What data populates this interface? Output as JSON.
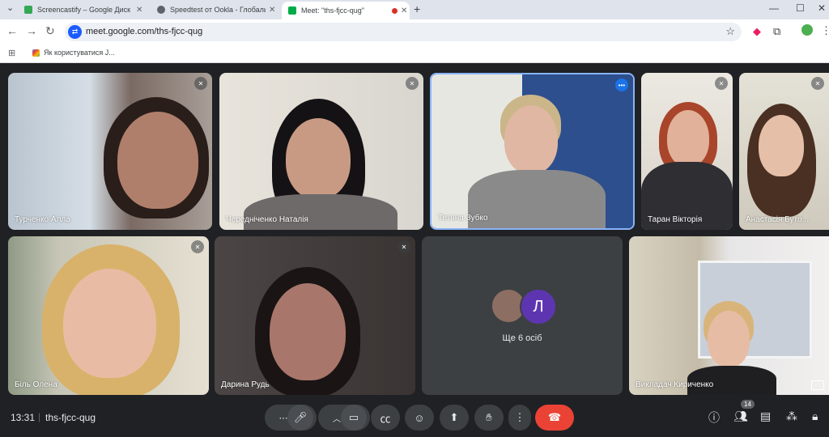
{
  "browser": {
    "tabs": [
      {
        "title": "Screencastify – Google Диск",
        "active": false
      },
      {
        "title": "Speedtest от Ookla - Глобальный",
        "active": false
      },
      {
        "title": "Meet: \"ths-fjcc-qug\"",
        "active": true
      }
    ],
    "url": "meet.google.com/ths-fjcc-qug",
    "bookmark": "Як користуватися J..."
  },
  "participants": [
    {
      "name": "Турченко Алла",
      "mic": "muted"
    },
    {
      "name": "Чередніченко Наталія",
      "mic": "muted"
    },
    {
      "name": "Тетяна Зубко",
      "mic": "speaking"
    },
    {
      "name": "Таран Вікторія",
      "mic": "muted"
    },
    {
      "name": "Анастасія Бутo...",
      "mic": "muted"
    },
    {
      "name": "Біль Олена",
      "mic": "muted"
    },
    {
      "name": "Дарина Рудь",
      "mic": "muted"
    },
    {
      "name": "Викладач Кириченко",
      "mic": ""
    }
  ],
  "others": {
    "avatar_letter": "Л",
    "label": "Ще 6 осіб"
  },
  "bottom": {
    "time": "13:31",
    "meeting_code": "ths-fjcc-qug",
    "people_count": "14"
  },
  "colors": {
    "end_call": "#ea4335",
    "speaking": "#1a73e8",
    "bar": "#202124"
  }
}
